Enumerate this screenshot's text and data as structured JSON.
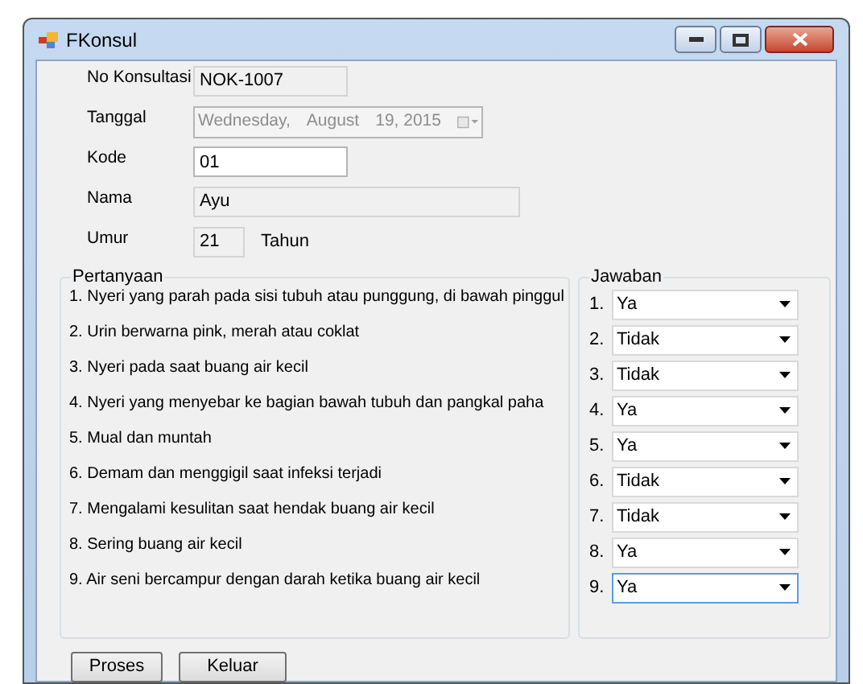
{
  "window": {
    "title": "FKonsul"
  },
  "fields": [
    {
      "label": "No Konsultasi",
      "kind": "readonly",
      "value": "NOK-1007"
    },
    {
      "label": "Tanggal",
      "kind": "date",
      "value": [
        "Wednesday,",
        "August",
        "19, 2015"
      ],
      "disabled": true
    },
    {
      "label": "Kode",
      "kind": "text",
      "value": "01"
    },
    {
      "label": "Nama",
      "kind": "readonly",
      "value": "Ayu"
    },
    {
      "label": "Umur",
      "kind": "age",
      "value": "21",
      "suffix": "Tahun"
    }
  ],
  "questions": {
    "title": "Pertanyaan",
    "items": [
      "1. Nyeri yang parah pada sisi tubuh atau punggung, di bawah pinggul",
      "2. Urin berwarna pink, merah atau coklat",
      "3. Nyeri pada saat buang air kecil",
      "4. Nyeri yang menyebar ke bagian bawah tubuh dan pangkal paha",
      "5. Mual dan muntah",
      "6. Demam dan menggigil saat infeksi terjadi",
      "7. Mengalami kesulitan saat hendak buang air kecil",
      "8. Sering buang air kecil",
      "9. Air seni bercampur dengan darah ketika buang air kecil"
    ]
  },
  "answers": {
    "title": "Jawaban",
    "items": [
      {
        "number": "1.",
        "value": "Ya",
        "focused": false
      },
      {
        "number": "2.",
        "value": "Tidak",
        "focused": false
      },
      {
        "number": "3.",
        "value": "Tidak",
        "focused": false
      },
      {
        "number": "4.",
        "value": "Ya",
        "focused": false
      },
      {
        "number": "5.",
        "value": "Ya",
        "focused": false
      },
      {
        "number": "6.",
        "value": "Tidak",
        "focused": false
      },
      {
        "number": "7.",
        "value": "Tidak",
        "focused": false
      },
      {
        "number": "8.",
        "value": "Ya",
        "focused": false
      },
      {
        "number": "9.",
        "value": "Ya",
        "focused": true
      }
    ]
  },
  "buttons": [
    "Proses",
    "Keluar"
  ]
}
